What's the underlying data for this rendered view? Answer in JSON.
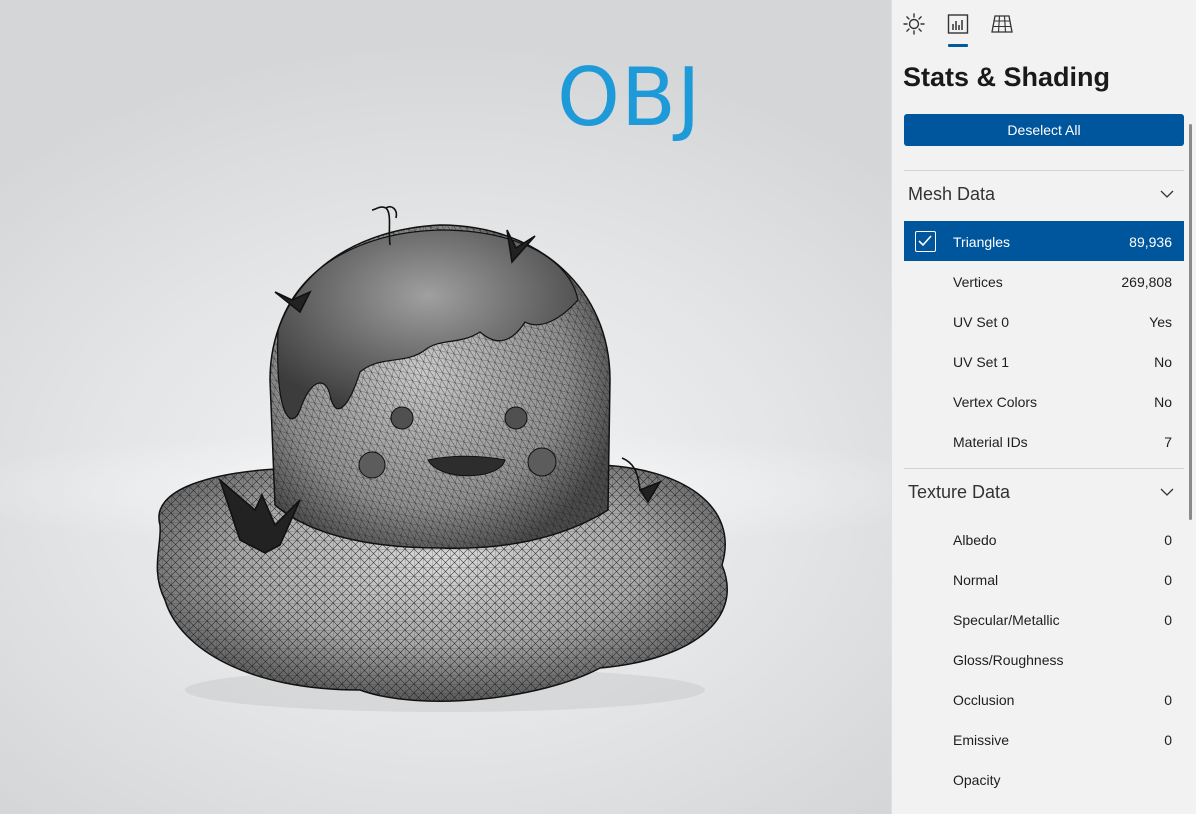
{
  "viewport": {
    "overlay_text": "OBJ",
    "overlay_color": "#1e9ad8",
    "model": "wireframe-creature-model"
  },
  "panel": {
    "tabs": [
      {
        "icon": "sun-icon",
        "name": "lighting"
      },
      {
        "icon": "bar-chart-icon",
        "name": "stats",
        "active": true
      },
      {
        "icon": "grid-icon",
        "name": "grid"
      }
    ],
    "title": "Stats & Shading",
    "deselect_label": "Deselect All",
    "accent": "#00569d",
    "mesh_section": {
      "title": "Mesh Data",
      "rows": [
        {
          "label": "Triangles",
          "value": "89,936",
          "selected": true
        },
        {
          "label": "Vertices",
          "value": "269,808"
        },
        {
          "label": "UV Set 0",
          "value": "Yes"
        },
        {
          "label": "UV Set 1",
          "value": "No"
        },
        {
          "label": "Vertex Colors",
          "value": "No"
        },
        {
          "label": "Material IDs",
          "value": "7"
        }
      ]
    },
    "texture_section": {
      "title": "Texture Data",
      "rows": [
        {
          "label": "Albedo",
          "value": "0"
        },
        {
          "label": "Normal",
          "value": "0"
        },
        {
          "label": "Specular/Metallic",
          "value": "0"
        },
        {
          "label": "Gloss/Roughness",
          "value": ""
        },
        {
          "label": "Occlusion",
          "value": "0"
        },
        {
          "label": "Emissive",
          "value": "0"
        },
        {
          "label": "Opacity",
          "value": ""
        }
      ]
    }
  }
}
